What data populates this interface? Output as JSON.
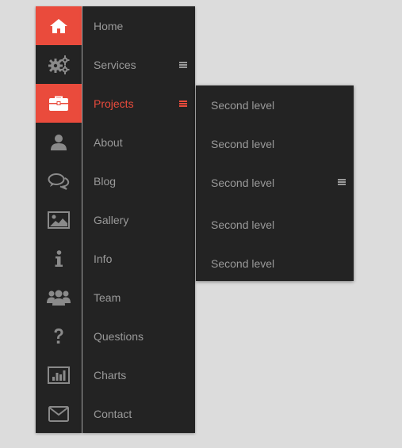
{
  "colors": {
    "accent": "#ea4b3c",
    "panel": "#232323",
    "text": "#9a9a9a",
    "background": "#dcdcdc"
  },
  "nav": {
    "items": [
      {
        "icon": "home-icon",
        "label": "Home",
        "active_icon": true
      },
      {
        "icon": "gears-icon",
        "label": "Services",
        "has_submenu": true
      },
      {
        "icon": "briefcase-icon",
        "label": "Projects",
        "active": true,
        "has_submenu": true
      },
      {
        "icon": "user-icon",
        "label": "About"
      },
      {
        "icon": "chat-bubbles-icon",
        "label": "Blog"
      },
      {
        "icon": "picture-icon",
        "label": "Gallery"
      },
      {
        "icon": "info-icon",
        "label": "Info"
      },
      {
        "icon": "group-icon",
        "label": "Team"
      },
      {
        "icon": "question-icon",
        "label": "Questions"
      },
      {
        "icon": "bar-chart-icon",
        "label": "Charts"
      },
      {
        "icon": "envelope-icon",
        "label": "Contact"
      }
    ]
  },
  "submenu": {
    "items": [
      {
        "label": "Second level"
      },
      {
        "label": "Second level"
      },
      {
        "label": "Second level",
        "has_submenu": true
      },
      {
        "label": "Second level"
      },
      {
        "label": "Second level"
      }
    ]
  }
}
